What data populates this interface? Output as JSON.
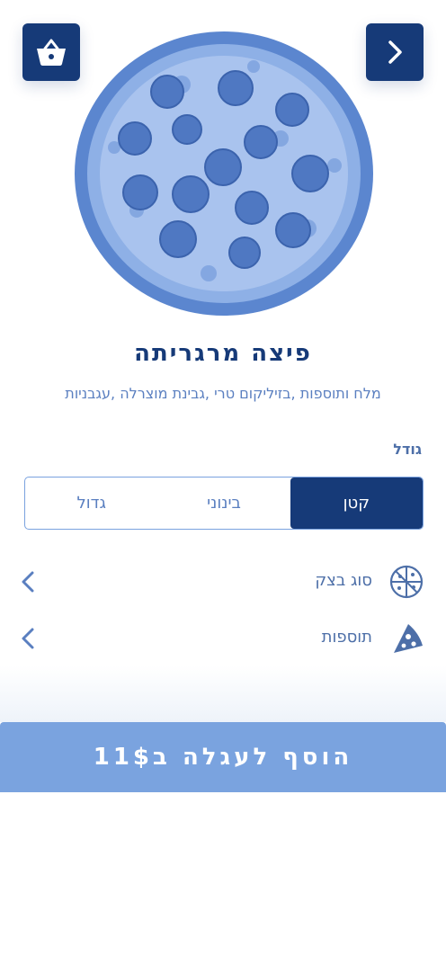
{
  "header": {
    "back_icon": "chevron-right-icon",
    "cart_icon": "basket-icon"
  },
  "product": {
    "name": "פיצה מרגריתה",
    "ingredients": "מלח ותוספות ,בזיליקום טרי ,גבינת מוצרלה ,עגבניות"
  },
  "size": {
    "label": "גודל",
    "options": [
      "קטן",
      "בינוני",
      "גדול"
    ],
    "selected": "קטן"
  },
  "options": [
    {
      "label": "סוג בצק",
      "icon": "pizza-slices-icon"
    },
    {
      "label": "תוספות",
      "icon": "pizza-slice-icon"
    }
  ],
  "cta": {
    "label": "הוסף לעגלה ב11$"
  },
  "colors": {
    "primary": "#163a78",
    "accent": "#7aa3df",
    "text_light": "#5a7fc0"
  }
}
